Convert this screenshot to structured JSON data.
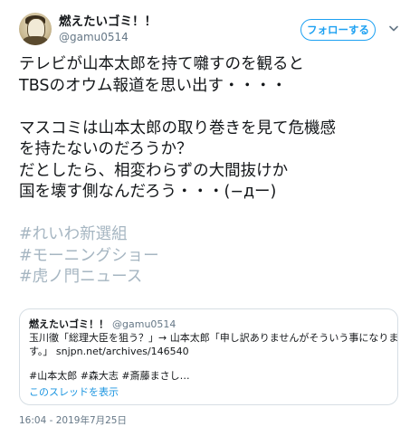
{
  "author": {
    "display_name": "燃えたいゴミ！！",
    "handle": "@gamu0514"
  },
  "follow_button": {
    "label": "フォローする"
  },
  "tweet": {
    "lines": [
      "テレビが山本太郎を持て囃すのを観ると",
      "TBSのオウム報道を思い出す・・・・",
      "",
      "マスコミは山本太郎の取り巻きを見て危機感",
      "を持たないのだろうか？",
      "だとしたら、相変わらずの大間抜けか",
      "国を壊す側なんだろう・・・(−дー)"
    ],
    "hashtags": [
      "#れいわ新選組",
      "#モーニングショー",
      "#虎ノ門ニュース"
    ]
  },
  "quoted_tweet": {
    "display_name": "燃えたいゴミ！！",
    "handle": "@gamu0514",
    "lines": [
      "玉川徹「総理大臣を狙う？」→ 山本太郎「申し訳ありませんがそういう事になりま",
      "す。」 snjpn.net/archives/146540"
    ],
    "tags": "#山本太郎 #森大志 #斎藤まさし…",
    "thread_link": "このスレッドを表示"
  },
  "timestamp": "16:04 - 2019年7月25日",
  "colors": {
    "accent": "#1da1f2",
    "hashtag": "#a6b6c2",
    "secondary_text": "#657786",
    "border": "#d6dee4"
  },
  "icons": {
    "caret": "chevron-down-icon",
    "avatar": "avatar"
  }
}
